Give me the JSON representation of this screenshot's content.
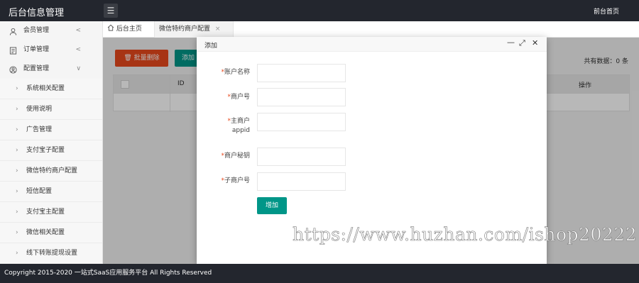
{
  "header": {
    "brand": "后台信息管理",
    "menu_icon": "list-icon",
    "front_link": "前台首页"
  },
  "sidebar": {
    "groups": [
      {
        "label": "会员管理",
        "icon": "user-icon",
        "expanded": false
      },
      {
        "label": "订单管理",
        "icon": "order-icon",
        "expanded": false
      },
      {
        "label": "配置管理",
        "icon": "settings-icon",
        "expanded": true
      }
    ],
    "sub_items": [
      "系统相关配置",
      "使用说明",
      "广告管理",
      "支付宝子配置",
      "微信特约商户配置",
      "短信配置",
      "支付宝主配置",
      "微信相关配置",
      "线下转账提现设置"
    ]
  },
  "tabs": {
    "home": "后台主页",
    "active": "微信特约商户配置",
    "close": "×"
  },
  "toolbar": {
    "batch_delete": "批量删除",
    "add": "添加",
    "total": "共有数据：0 条"
  },
  "table": {
    "columns": [
      "ID",
      "操作"
    ]
  },
  "modal": {
    "title": "添加",
    "fields": [
      {
        "label": "账户名称",
        "value": ""
      },
      {
        "label": "商户号",
        "value": ""
      },
      {
        "label": "主商户appid",
        "label_line1": "主商户",
        "label_line2": "appid",
        "value": ""
      },
      {
        "label": "商户秘钥",
        "value": ""
      },
      {
        "label": "子商户号",
        "value": ""
      }
    ],
    "required_mark": "*",
    "submit": "增加",
    "minimize": "—",
    "maximize": "⤢",
    "close": "✕"
  },
  "footer": {
    "text": "Copyright 2015-2020 一站式SaaS应用服务平台 All Rights Reserved"
  },
  "watermark": "https://www.huzhan.com/ishop20222",
  "colors": {
    "header_bg": "#23262e",
    "danger": "#e8491d",
    "primary": "#009688"
  }
}
